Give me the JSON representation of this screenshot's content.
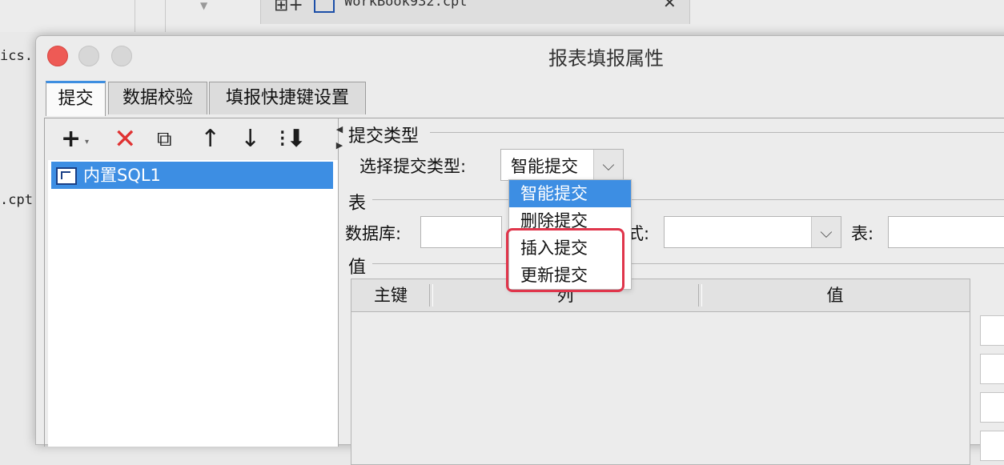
{
  "background": {
    "tab_title": "WorkBook932.cpt",
    "left_text_1": "ics.",
    "left_text_2": ".cpt"
  },
  "dialog": {
    "title": "报表填报属性",
    "tabs": [
      {
        "label": "提交"
      },
      {
        "label": "数据校验"
      },
      {
        "label": "填报快捷键设置"
      }
    ],
    "tree": {
      "items": [
        {
          "label": "内置SQL1"
        }
      ]
    },
    "submit_type": {
      "section_title": "提交类型",
      "label": "选择提交类型:",
      "selected": "智能提交",
      "options": [
        "智能提交",
        "删除提交",
        "插入提交",
        "更新提交"
      ]
    },
    "table_section": {
      "section_title": "表",
      "database_label": "数据库:",
      "schema_label_tail": "式:",
      "table_label": "表:"
    },
    "value_section": {
      "section_title": "值",
      "columns": [
        "主键",
        "列",
        "值"
      ]
    }
  },
  "colors": {
    "accent": "#3d8ee3",
    "highlight_border": "#e0354b",
    "close_light": "#ee5a55"
  }
}
